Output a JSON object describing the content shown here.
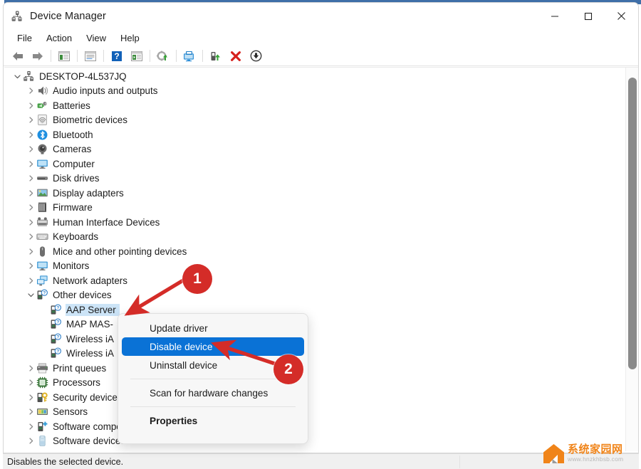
{
  "window": {
    "title": "Device Manager",
    "title_icon": "device-manager-icon",
    "controls": [
      {
        "name": "minimize-button",
        "glyph": "minimize"
      },
      {
        "name": "maximize-button",
        "glyph": "maximize"
      },
      {
        "name": "close-button",
        "glyph": "close"
      }
    ]
  },
  "menubar": {
    "items": [
      {
        "label": "File",
        "name": "menu-file"
      },
      {
        "label": "Action",
        "name": "menu-action"
      },
      {
        "label": "View",
        "name": "menu-view"
      },
      {
        "label": "Help",
        "name": "menu-help"
      }
    ]
  },
  "toolbar": {
    "buttons": [
      {
        "name": "back-button",
        "icon": "left-arrow-icon"
      },
      {
        "name": "forward-button",
        "icon": "right-arrow-icon"
      },
      {
        "name": "separator-1",
        "icon": "separator"
      },
      {
        "name": "show-hide-console-tree-button",
        "icon": "console-tree-icon"
      },
      {
        "name": "separator-2",
        "icon": "separator"
      },
      {
        "name": "properties-button",
        "icon": "properties-window-icon"
      },
      {
        "name": "separator-3",
        "icon": "separator"
      },
      {
        "name": "help-button",
        "icon": "question-mark-icon"
      },
      {
        "name": "show-hide-action-pane-button",
        "icon": "action-pane-icon"
      },
      {
        "name": "separator-4",
        "icon": "separator"
      },
      {
        "name": "update-driver-button",
        "icon": "update-driver-icon"
      },
      {
        "name": "separator-5",
        "icon": "separator"
      },
      {
        "name": "scan-hardware-changes-button",
        "icon": "monitor-scan-icon"
      },
      {
        "name": "separator-6",
        "icon": "separator"
      },
      {
        "name": "enable-device-button",
        "icon": "enable-device-icon"
      },
      {
        "name": "uninstall-device-button",
        "icon": "red-x-icon"
      },
      {
        "name": "disable-device-button",
        "icon": "down-arrow-circle-icon"
      }
    ]
  },
  "tree": {
    "rows": [
      {
        "label": "DESKTOP-4L537JQ",
        "level": 0,
        "expander": "expanded",
        "icon": "computer-root-icon",
        "selected": false
      },
      {
        "label": "Audio inputs and outputs",
        "level": 1,
        "expander": "collapsed",
        "icon": "speaker-icon",
        "selected": false
      },
      {
        "label": "Batteries",
        "level": 1,
        "expander": "collapsed",
        "icon": "battery-icon",
        "selected": false
      },
      {
        "label": "Biometric devices",
        "level": 1,
        "expander": "collapsed",
        "icon": "fingerprint-icon",
        "selected": false
      },
      {
        "label": "Bluetooth",
        "level": 1,
        "expander": "collapsed",
        "icon": "bluetooth-icon",
        "selected": false
      },
      {
        "label": "Cameras",
        "level": 1,
        "expander": "collapsed",
        "icon": "camera-icon",
        "selected": false
      },
      {
        "label": "Computer",
        "level": 1,
        "expander": "collapsed",
        "icon": "monitor-icon",
        "selected": false
      },
      {
        "label": "Disk drives",
        "level": 1,
        "expander": "collapsed",
        "icon": "disk-drive-icon",
        "selected": false
      },
      {
        "label": "Display adapters",
        "level": 1,
        "expander": "collapsed",
        "icon": "display-adapter-icon",
        "selected": false
      },
      {
        "label": "Firmware",
        "level": 1,
        "expander": "collapsed",
        "icon": "firmware-chip-icon",
        "selected": false
      },
      {
        "label": "Human Interface Devices",
        "level": 1,
        "expander": "collapsed",
        "icon": "hid-icon",
        "selected": false
      },
      {
        "label": "Keyboards",
        "level": 1,
        "expander": "collapsed",
        "icon": "keyboard-icon",
        "selected": false
      },
      {
        "label": "Mice and other pointing devices",
        "level": 1,
        "expander": "collapsed",
        "icon": "mouse-icon",
        "selected": false
      },
      {
        "label": "Monitors",
        "level": 1,
        "expander": "collapsed",
        "icon": "monitor-icon",
        "selected": false
      },
      {
        "label": "Network adapters",
        "level": 1,
        "expander": "collapsed",
        "icon": "network-adapter-icon",
        "selected": false
      },
      {
        "label": "Other devices",
        "level": 1,
        "expander": "expanded",
        "icon": "unknown-device-icon",
        "selected": false
      },
      {
        "label": "AAP Server",
        "level": 2,
        "expander": "none",
        "icon": "unknown-device-icon",
        "selected": true
      },
      {
        "label": "MAP MAS-",
        "level": 2,
        "expander": "none",
        "icon": "unknown-device-icon",
        "selected": false
      },
      {
        "label": "Wireless iA",
        "level": 2,
        "expander": "none",
        "icon": "unknown-device-icon",
        "selected": false
      },
      {
        "label": "Wireless iA",
        "level": 2,
        "expander": "none",
        "icon": "unknown-device-icon",
        "selected": false
      },
      {
        "label": "Print queues",
        "level": 1,
        "expander": "collapsed",
        "icon": "printer-icon",
        "selected": false
      },
      {
        "label": "Processors",
        "level": 1,
        "expander": "collapsed",
        "icon": "processor-icon",
        "selected": false
      },
      {
        "label": "Security device",
        "level": 1,
        "expander": "collapsed",
        "icon": "security-device-icon",
        "selected": false
      },
      {
        "label": "Sensors",
        "level": 1,
        "expander": "collapsed",
        "icon": "sensor-icon",
        "selected": false
      },
      {
        "label": "Software components",
        "level": 1,
        "expander": "collapsed",
        "icon": "software-component-icon",
        "selected": false
      },
      {
        "label": "Software devices",
        "level": 1,
        "expander": "collapsed",
        "icon": "software-device-icon",
        "selected": false
      }
    ]
  },
  "context_menu": {
    "items": [
      {
        "label": "Update driver",
        "name": "ctx-update-driver",
        "kind": "item"
      },
      {
        "label": "Disable device",
        "name": "ctx-disable-device",
        "kind": "item-highlighted"
      },
      {
        "label": "Uninstall device",
        "name": "ctx-uninstall-device",
        "kind": "item"
      },
      {
        "label": "",
        "name": "ctx-separator-1",
        "kind": "separator"
      },
      {
        "label": "Scan for hardware changes",
        "name": "ctx-scan-hardware-changes",
        "kind": "item"
      },
      {
        "label": "",
        "name": "ctx-separator-2",
        "kind": "separator"
      },
      {
        "label": "Properties",
        "name": "ctx-properties",
        "kind": "item-bold"
      }
    ],
    "highlight_color": "#0a72d6"
  },
  "annotations": {
    "badges": [
      {
        "number": "1",
        "name": "annotation-badge-1"
      },
      {
        "number": "2",
        "name": "annotation-badge-2"
      }
    ],
    "color": "#d42c28"
  },
  "statusbar": {
    "text": "Disables the selected device."
  },
  "watermark": {
    "brand_cn": "系统家园网",
    "url": "www.hnzkhbsb.com",
    "color": "#f08419"
  }
}
